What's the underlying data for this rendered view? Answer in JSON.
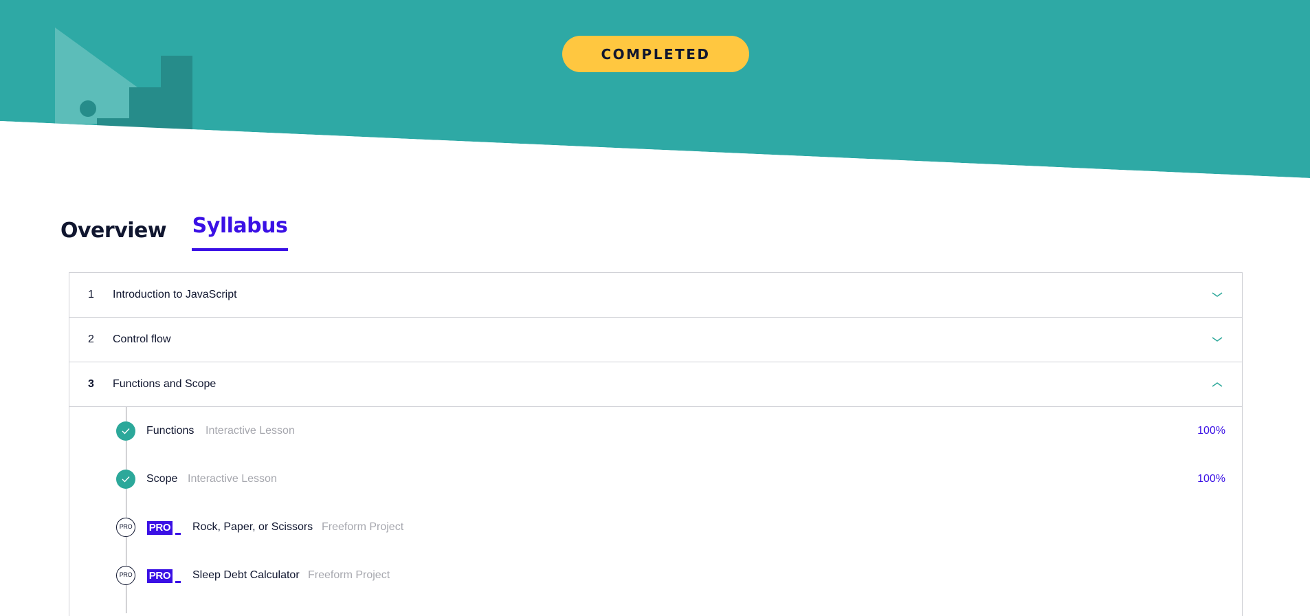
{
  "hero": {
    "status_label": "COMPLETED",
    "colors": {
      "background": "#2ea9a5",
      "status_pill": "#ffc740",
      "illustration_light": "#5cbdb9",
      "illustration_dark": "#268c8a"
    }
  },
  "tabs": [
    {
      "label": "Overview",
      "active": false
    },
    {
      "label": "Syllabus",
      "active": true
    }
  ],
  "modules": [
    {
      "number": "1",
      "title": "Introduction to JavaScript",
      "expanded": false,
      "icon": "chevron-down-icon"
    },
    {
      "number": "2",
      "title": "Control flow",
      "expanded": false,
      "icon": "chevron-down-icon"
    },
    {
      "number": "3",
      "title": "Functions and Scope",
      "expanded": true,
      "icon": "chevron-up-icon"
    }
  ],
  "lessons": [
    {
      "title": "Functions",
      "type": "Interactive Lesson",
      "progress": "100%",
      "status": "completed",
      "icon": "check-icon"
    },
    {
      "title": "Scope",
      "type": "Interactive Lesson",
      "progress": "100%",
      "status": "completed",
      "icon": "check-icon"
    },
    {
      "title": "Rock, Paper, or Scissors",
      "type": "Freeform Project",
      "status": "pro",
      "marker": "PRO",
      "badge": "PRO"
    },
    {
      "title": "Sleep Debt Calculator",
      "type": "Freeform Project",
      "status": "pro",
      "marker": "PRO",
      "badge": "PRO"
    }
  ],
  "colors": {
    "accent": "#3a10e5",
    "text": "#10162f",
    "muted": "#a6a7ae",
    "border": "#cfd0d5",
    "check": "#2ca89a"
  }
}
